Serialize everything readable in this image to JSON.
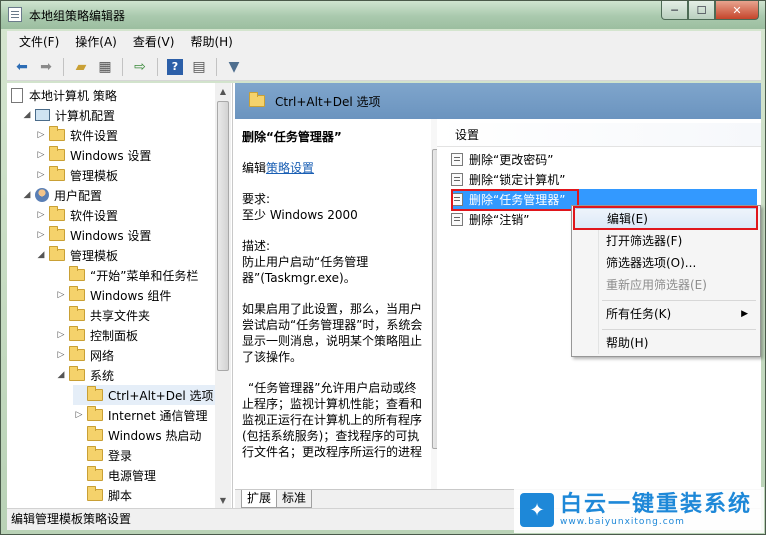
{
  "window": {
    "title": "本地组策略编辑器",
    "min": "─",
    "max": "☐",
    "close": "✕"
  },
  "menu": [
    "文件(F)",
    "操作(A)",
    "查看(V)",
    "帮助(H)"
  ],
  "toolbar_icons": [
    "back-arrow-icon",
    "forward-arrow-icon",
    "up-folder-icon",
    "show-hide-tree-icon",
    "export-icon",
    "help-icon",
    "properties-icon",
    "filter-icon"
  ],
  "tree": [
    {
      "label": "本地计算机 策略",
      "indent": 0,
      "icon": "doc",
      "arrow": ""
    },
    {
      "label": "计算机配置",
      "indent": 1,
      "icon": "pc",
      "arrow": "◢"
    },
    {
      "label": "软件设置",
      "indent": 2,
      "icon": "folder",
      "arrow": "▷"
    },
    {
      "label": "Windows 设置",
      "indent": 2,
      "icon": "folder",
      "arrow": "▷"
    },
    {
      "label": "管理模板",
      "indent": 2,
      "icon": "folder",
      "arrow": "▷"
    },
    {
      "label": "用户配置",
      "indent": 1,
      "icon": "user",
      "arrow": "◢"
    },
    {
      "label": "软件设置",
      "indent": 2,
      "icon": "folder",
      "arrow": "▷"
    },
    {
      "label": "Windows 设置",
      "indent": 2,
      "icon": "folder",
      "arrow": "▷"
    },
    {
      "label": "管理模板",
      "indent": 2,
      "icon": "folder",
      "arrow": "◢"
    },
    {
      "label": "“开始”菜单和任务栏",
      "indent": 3,
      "icon": "folder",
      "arrow": ""
    },
    {
      "label": "Windows 组件",
      "indent": 3,
      "icon": "folder",
      "arrow": "▷"
    },
    {
      "label": "共享文件夹",
      "indent": 3,
      "icon": "folder",
      "arrow": ""
    },
    {
      "label": "控制面板",
      "indent": 3,
      "icon": "folder",
      "arrow": "▷"
    },
    {
      "label": "网络",
      "indent": 3,
      "icon": "folder",
      "arrow": "▷"
    },
    {
      "label": "系统",
      "indent": 3,
      "icon": "folder",
      "arrow": "◢"
    },
    {
      "label": "Ctrl+Alt+Del 选项",
      "indent": 4,
      "icon": "folder",
      "arrow": "",
      "selected": true
    },
    {
      "label": "Internet 通信管理",
      "indent": 4,
      "icon": "folder",
      "arrow": "▷"
    },
    {
      "label": "Windows 热启动",
      "indent": 4,
      "icon": "folder",
      "arrow": ""
    },
    {
      "label": "登录",
      "indent": 4,
      "icon": "folder",
      "arrow": ""
    },
    {
      "label": "电源管理",
      "indent": 4,
      "icon": "folder",
      "arrow": ""
    },
    {
      "label": "脚本",
      "indent": 4,
      "icon": "folder",
      "arrow": ""
    }
  ],
  "right_header": "Ctrl+Alt+Del 选项",
  "description": {
    "title": "删除“任务管理器”",
    "edit_prefix": "编辑",
    "edit_link": "策略设置",
    "requirement_label": "要求:",
    "requirement_value": "至少 Windows 2000",
    "desc_label": "描述:",
    "desc_line": "防止用户启动“任务管理器”(Taskmgr.exe)。",
    "para1": "如果启用了此设置，那么，当用户尝试启动“任务管理器”时，系统会显示一则消息，说明某个策略阻止了该操作。",
    "para2": "“任务管理器”允许用户启动或终止程序；监视计算机性能；查看和监视正运行在计算机上的所有程序(包括系统服务)；查找程序的可执行文件名；更改程序所运行的进程"
  },
  "settings": {
    "column_header": "设置",
    "items": [
      "删除“更改密码”",
      "删除“锁定计算机”",
      "删除“任务管理器”",
      "删除“注销”"
    ]
  },
  "tabs": [
    "扩展",
    "标准"
  ],
  "context_menu": {
    "edit": "编辑(E)",
    "open_filter": "打开筛选器(F)",
    "filter_options": "筛选器选项(O)...",
    "reapply_filter": "重新应用筛选器(E)",
    "all_tasks": "所有任务(K)",
    "help": "帮助(H)"
  },
  "status": "编辑管理模板策略设置",
  "watermark": {
    "main": "白云一键重装系统",
    "sub": "www.baiyunxitong.com"
  },
  "colors": {
    "selection": "#3399ff",
    "highlight_box": "#e0161c",
    "header": "#7fa5cc",
    "watermark": "#1e88d8"
  }
}
